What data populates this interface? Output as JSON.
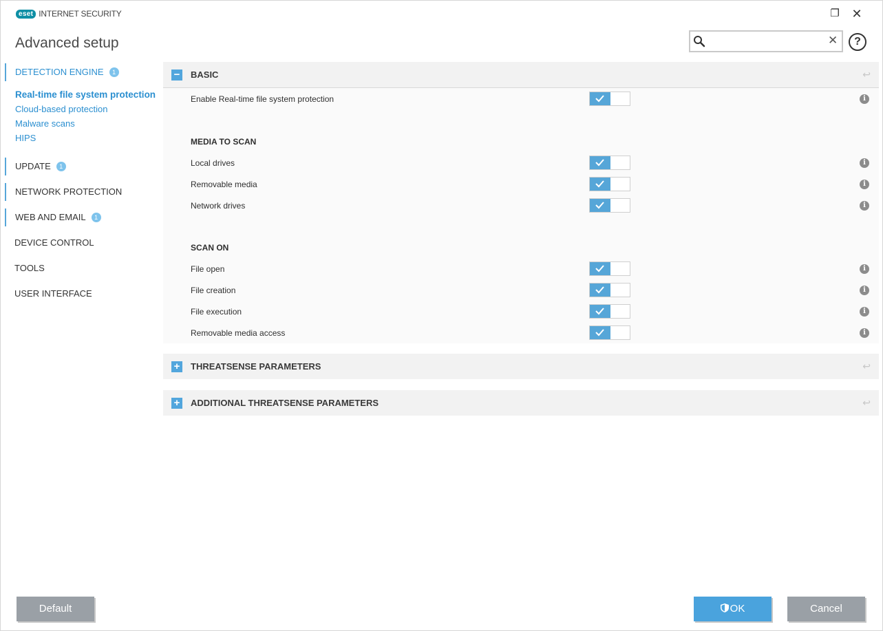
{
  "window": {
    "logo_badge": "eset",
    "product_name": "INTERNET SECURITY",
    "restore_glyph": "❐",
    "close_glyph": "✕"
  },
  "page_title": "Advanced setup",
  "search": {
    "value": "",
    "placeholder": "",
    "clear_glyph": "✕"
  },
  "help_glyph": "?",
  "sidebar": {
    "sections": [
      {
        "label": "DETECTION ENGINE",
        "badge": "1"
      },
      {
        "label": "UPDATE",
        "badge": "1"
      },
      {
        "label": "NETWORK PROTECTION"
      },
      {
        "label": "WEB AND EMAIL",
        "badge": "1"
      },
      {
        "label": "DEVICE CONTROL"
      },
      {
        "label": "TOOLS"
      },
      {
        "label": "USER INTERFACE"
      }
    ],
    "detection_subitems": [
      "Real-time file system protection",
      "Cloud-based protection",
      "Malware scans",
      "HIPS"
    ]
  },
  "main": {
    "basic": {
      "title": "BASIC",
      "toggle_glyph": "−",
      "enable_label": "Enable Real-time file system protection",
      "enable_on": true
    },
    "media_to_scan": {
      "title": "MEDIA TO SCAN",
      "items": [
        {
          "label": "Local drives",
          "on": true
        },
        {
          "label": "Removable media",
          "on": true
        },
        {
          "label": "Network drives",
          "on": true
        }
      ]
    },
    "scan_on": {
      "title": "SCAN ON",
      "items": [
        {
          "label": "File open",
          "on": true
        },
        {
          "label": "File creation",
          "on": true
        },
        {
          "label": "File execution",
          "on": true
        },
        {
          "label": "Removable media access",
          "on": true
        }
      ]
    },
    "threatsense": {
      "title": "THREATSENSE PARAMETERS",
      "toggle_glyph": "+"
    },
    "additional_threatsense": {
      "title": "ADDITIONAL THREATSENSE PARAMETERS",
      "toggle_glyph": "+"
    },
    "info_glyph": "i",
    "revert_glyph": "↩"
  },
  "footer": {
    "default_label": "Default",
    "ok_label": "OK",
    "cancel_label": "Cancel"
  },
  "colors": {
    "accent": "#52a6dd",
    "button_gray": "#9aa0a6",
    "logo": "#0e8fa5"
  }
}
